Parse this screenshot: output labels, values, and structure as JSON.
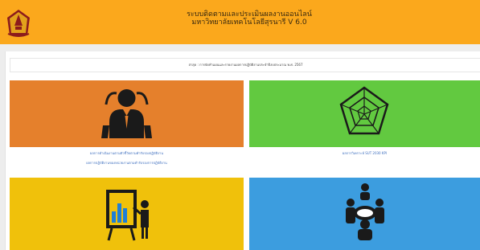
{
  "header": {
    "title_line1": "ระบบติดตามและประเมินผลงานออนไลน์",
    "title_line2": "มหาวิทยาลัยเทคโนโลยีสุรนารี V 6.0",
    "background_color": "#fba81c"
  },
  "announcement": {
    "text": "ล่าสุด : การจัดทำแผนและรายงานผลการปฏิบัติงานประจำปีงบประมาณ พ.ศ. 2567"
  },
  "tiles": [
    {
      "color": "#e5802c",
      "icon": "presenter-person-icon",
      "links": [
        "ผลการดำเนินงานตามตัวชี้วัดตามคำรับรองปฏิบัติงาน",
        "ผลการปฏิบัติงานของหน่วยงานตามคำรับรองการปฏิบัติงาน"
      ]
    },
    {
      "color": "#62c940",
      "icon": "radar-chart-icon",
      "links": [
        "ผลการวิเคราะห์ SUT 2030 KPI"
      ]
    },
    {
      "color": "#f0c10b",
      "icon": "presentation-board-icon",
      "links": []
    },
    {
      "color": "#3c9ddf",
      "icon": "meeting-group-icon",
      "links": []
    }
  ]
}
